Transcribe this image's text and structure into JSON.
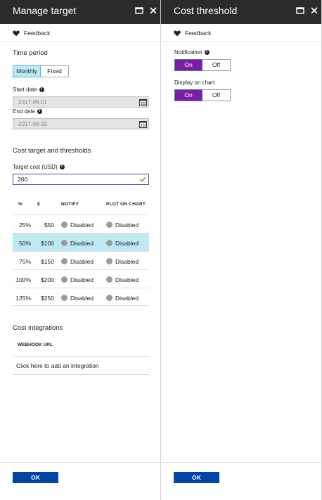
{
  "colors": {
    "header_bg": "#2b2b2b",
    "selected_row": "#bde9f5",
    "toggle_on": "#7b1fa2",
    "ok_button": "#0046a8",
    "input_border_active": "#6b3aa5",
    "check": "#58a42c"
  },
  "left": {
    "title": "Manage target",
    "feedback_label": "Feedback",
    "time_period": {
      "title": "Time period",
      "options": [
        "Monthly",
        "Fixed"
      ],
      "selected": "Monthly"
    },
    "start_date": {
      "label": "Start date",
      "value": "2017-06-01"
    },
    "end_date": {
      "label": "End date",
      "value": "2017-06-30"
    },
    "thresholds_title": "Cost target and thresholds",
    "target_cost": {
      "label": "Target cost (USD)",
      "value": "200"
    },
    "table": {
      "headers": {
        "pct": "%",
        "amount": "$",
        "notify": "NOTIFY",
        "plot": "PLOT ON CHART"
      },
      "rows": [
        {
          "pct": "25%",
          "amount": "$50",
          "notify": "Disabled",
          "plot": "Disabled"
        },
        {
          "pct": "50%",
          "amount": "$100",
          "notify": "Disabled",
          "plot": "Disabled"
        },
        {
          "pct": "75%",
          "amount": "$150",
          "notify": "Disabled",
          "plot": "Disabled"
        },
        {
          "pct": "100%",
          "amount": "$200",
          "notify": "Disabled",
          "plot": "Disabled"
        },
        {
          "pct": "125%",
          "amount": "$250",
          "notify": "Disabled",
          "plot": "Disabled"
        }
      ],
      "selected_row": 1
    },
    "integrations": {
      "title": "Cost integrations",
      "column_header": "WEBHOOK URL",
      "add_link": "Click here to add an integration"
    },
    "ok_label": "OK"
  },
  "right": {
    "title": "Cost threshold",
    "feedback_label": "Feedback",
    "notification": {
      "label": "Notification",
      "options": [
        "On",
        "Off"
      ],
      "selected": "On"
    },
    "display_on_chart": {
      "label": "Display on chart",
      "options": [
        "On",
        "Off"
      ],
      "selected": "On"
    },
    "ok_label": "OK"
  }
}
